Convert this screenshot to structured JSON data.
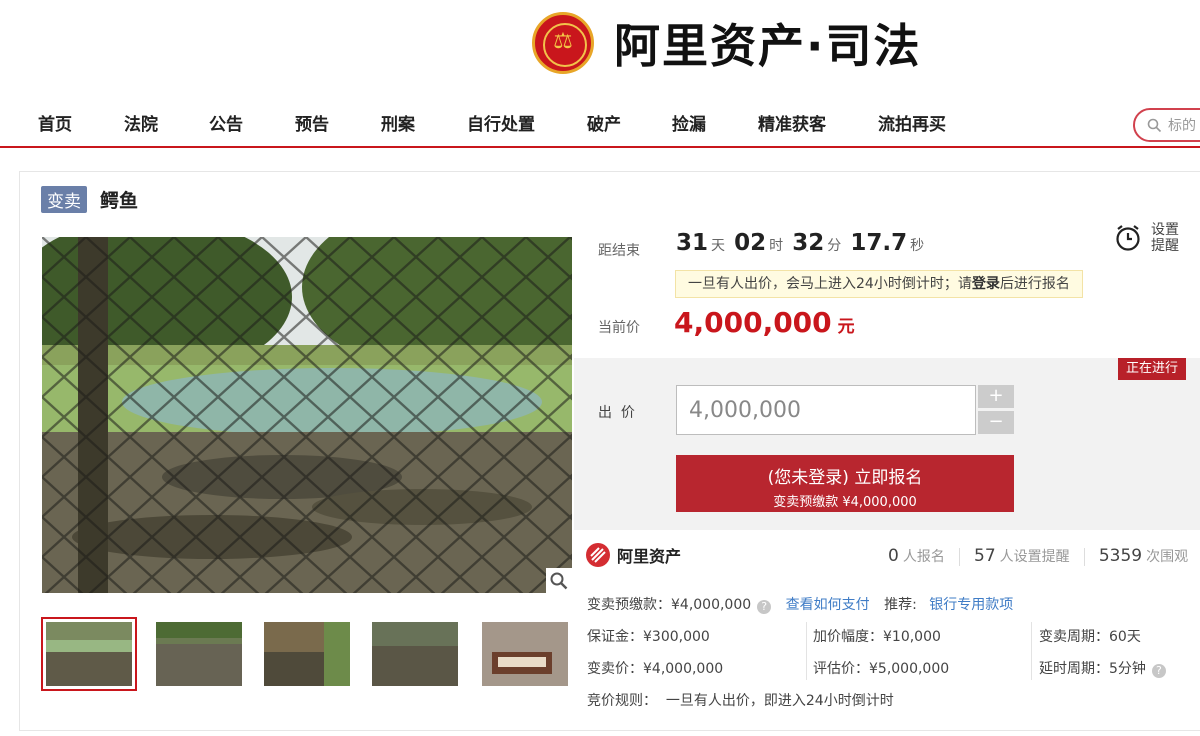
{
  "brand": {
    "emblem_glyph": "⚖",
    "name": "阿里资产·司法"
  },
  "nav": [
    "首页",
    "法院",
    "公告",
    "预告",
    "刑案",
    "自行处置",
    "破产",
    "捡漏",
    "精准获客",
    "流拍再买"
  ],
  "search": {
    "placeholder": "标的"
  },
  "item": {
    "tag": "变卖",
    "title": "鳄鱼"
  },
  "countdown": {
    "label": "距结束",
    "days": "31",
    "days_unit": "天",
    "hours": "02",
    "hours_unit": "时",
    "minutes": "32",
    "minutes_unit": "分",
    "seconds": "17.7",
    "seconds_unit": "秒"
  },
  "reminder": {
    "label": "设置提醒"
  },
  "notice": {
    "prefix": "一旦有人出价，会马上进入24小时倒计时；请",
    "link": "登录",
    "suffix": "后进行报名"
  },
  "price": {
    "label": "当前价",
    "value": "4,000,000",
    "unit": "元"
  },
  "status": "正在进行",
  "bid": {
    "label": "出  价",
    "value": "4,000,000",
    "plus": "+",
    "minus": "−"
  },
  "signup": {
    "line1": "(您未登录) 立即报名",
    "line2": "变卖预缴款 ¥4,000,000"
  },
  "platform": "阿里资产",
  "stats": [
    {
      "num": "0",
      "unit": "人报名"
    },
    {
      "num": "57",
      "unit": "人设置提醒"
    },
    {
      "num": "5359",
      "unit": "次围观"
    }
  ],
  "deposit": {
    "text": "变卖预缴款：¥4,000,000",
    "pay_link": "查看如何支付",
    "rec_label": "推荐:",
    "rec_link": "银行专用款项"
  },
  "details": {
    "bond": "保证金：¥300,000",
    "increment": "加价幅度：¥10,000",
    "period": "变卖周期：60天",
    "sale_price": "变卖价：¥4,000,000",
    "appraisal": "评估价：¥5,000,000",
    "extension": "延时周期：5分钟",
    "rule": "竞价规则：  一旦有人出价，即进入24小时倒计时"
  },
  "colors": {
    "brand_red": "#c9161c",
    "button_red": "#b8262f",
    "link_blue": "#3f7cc6",
    "tag_blue": "#6a7fa8"
  },
  "icons": [
    "magnifier-icon",
    "alarm-clock-icon",
    "help-icon",
    "search-icon"
  ]
}
